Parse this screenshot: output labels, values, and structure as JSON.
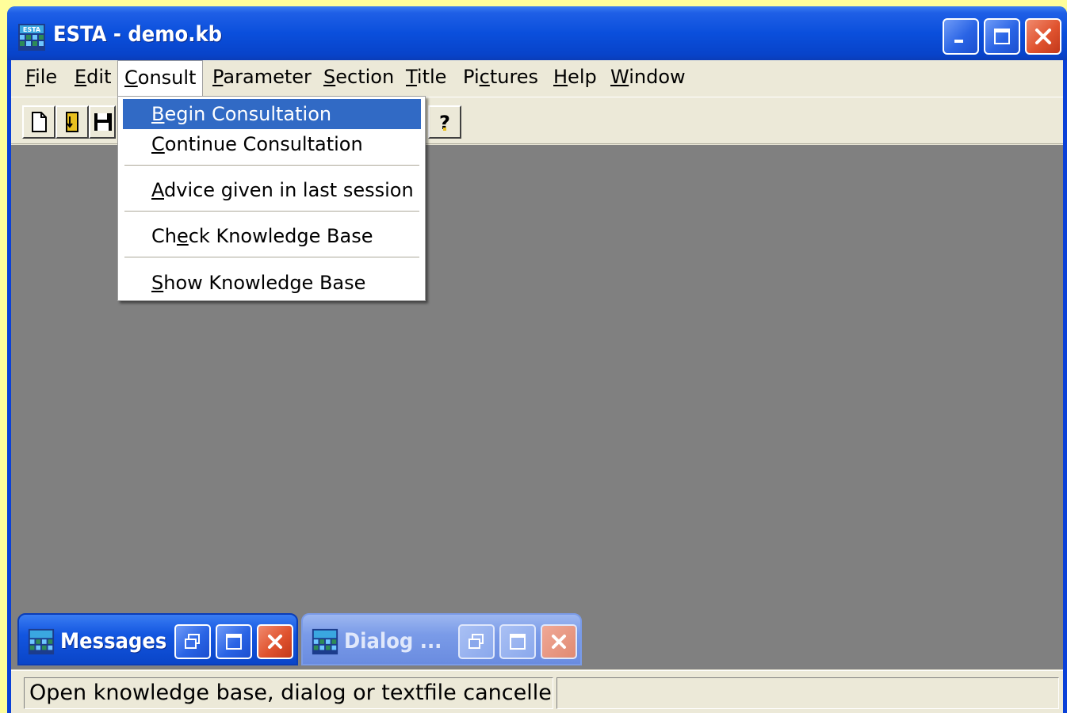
{
  "window": {
    "title": "ESTA - demo.kb"
  },
  "menubar": {
    "items": [
      {
        "pre": "",
        "u": "F",
        "post": "ile"
      },
      {
        "pre": "",
        "u": "E",
        "post": "dit"
      },
      {
        "pre": "",
        "u": "C",
        "post": "onsult"
      },
      {
        "pre": "",
        "u": "P",
        "post": "arameter"
      },
      {
        "pre": "",
        "u": "S",
        "post": "ection"
      },
      {
        "pre": "",
        "u": "T",
        "post": "itle"
      },
      {
        "pre": "Pi",
        "u": "c",
        "post": "tures"
      },
      {
        "pre": "",
        "u": "H",
        "post": "elp"
      },
      {
        "pre": "",
        "u": "W",
        "post": "indow"
      }
    ]
  },
  "consult_menu": {
    "items": [
      {
        "pre": "",
        "u": "B",
        "post": "egin Consultation"
      },
      {
        "pre": "",
        "u": "C",
        "post": "ontinue Consultation"
      },
      {
        "pre": "",
        "u": "A",
        "post": "dvice given in last session"
      },
      {
        "pre": "Ch",
        "u": "e",
        "post": "ck Knowledge Base"
      },
      {
        "pre": "",
        "u": "S",
        "post": "how Knowledge Base"
      }
    ]
  },
  "toolbar": {
    "icons": [
      "new-file-icon",
      "open-file-icon",
      "save-icon",
      "help-icon"
    ]
  },
  "minimized_windows": {
    "messages_title": "Messages",
    "dialog_title": "Dialog ..."
  },
  "statusbar": {
    "message": "Open knowledge base, dialog or textfile cancelled",
    "secondary": ""
  },
  "colors": {
    "title_blue": "#0a4fdc",
    "menu_highlight": "#316ac5",
    "close_red": "#e0532f",
    "mdi_gray": "#808080",
    "desktop_yellow": "#fffe9a"
  }
}
